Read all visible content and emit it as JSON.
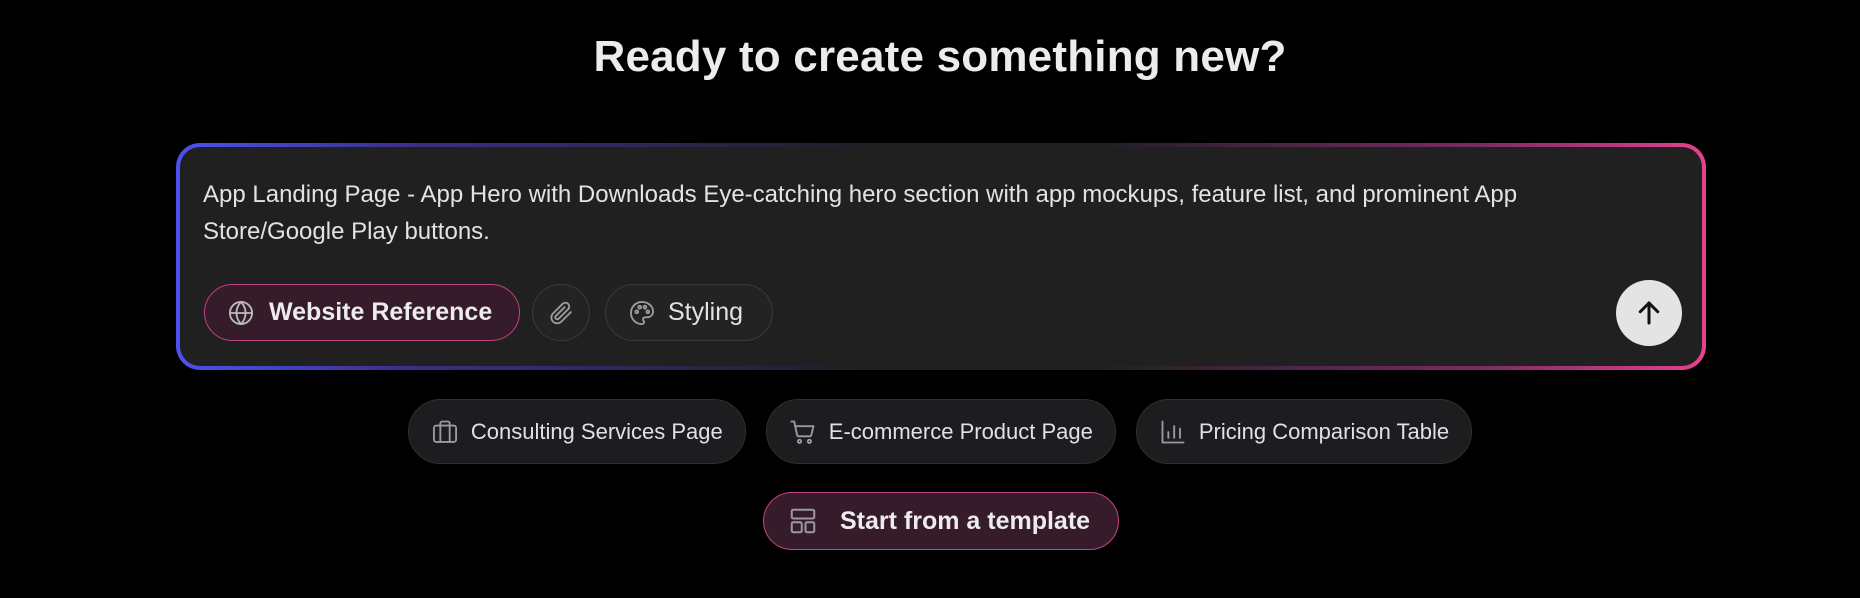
{
  "header": {
    "title": "Ready to create something new?"
  },
  "composer": {
    "prompt": "App Landing Page - App Hero with Downloads Eye-catching hero section with app mockups, feature list, and prominent App Store/Google Play buttons.",
    "website_reference_label": "Website Reference",
    "styling_label": "Styling",
    "icons": {
      "website_reference": "globe-icon",
      "attach": "paperclip-icon",
      "styling": "palette-icon",
      "send": "arrow-up-icon"
    }
  },
  "suggestions": [
    {
      "label": "Consulting Services Page",
      "icon": "briefcase-icon"
    },
    {
      "label": "E-commerce Product Page",
      "icon": "cart-icon"
    },
    {
      "label": "Pricing Comparison Table",
      "icon": "bar-chart-icon"
    }
  ],
  "template": {
    "label": "Start from a template",
    "icon": "layout-icon"
  },
  "colors": {
    "background": "#000000",
    "composer_bg": "#202020",
    "accent_pink": "#e6428f",
    "accent_blue": "#4d52f0",
    "pill_active_bg": "#361b2a"
  }
}
